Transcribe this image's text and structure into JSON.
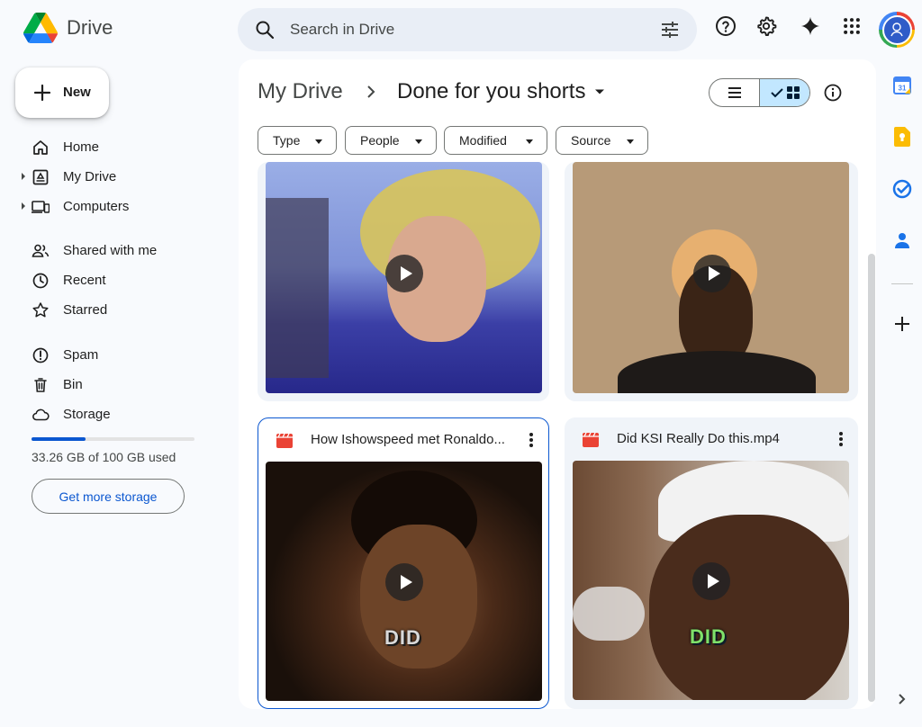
{
  "app": {
    "name": "Drive"
  },
  "search": {
    "placeholder": "Search in Drive"
  },
  "new_button": {
    "label": "New"
  },
  "nav": {
    "items": [
      {
        "label": "Home",
        "icon": "home-icon"
      },
      {
        "label": "My Drive",
        "icon": "my-drive-icon",
        "expandable": true
      },
      {
        "label": "Computers",
        "icon": "computers-icon",
        "expandable": true
      },
      {
        "label": "Shared with me",
        "icon": "shared-icon"
      },
      {
        "label": "Recent",
        "icon": "clock-icon"
      },
      {
        "label": "Starred",
        "icon": "star-icon"
      },
      {
        "label": "Spam",
        "icon": "spam-icon"
      },
      {
        "label": "Bin",
        "icon": "trash-icon"
      },
      {
        "label": "Storage",
        "icon": "cloud-icon"
      }
    ]
  },
  "storage": {
    "used_text": "33.26 GB of 100 GB used",
    "used_fraction": 0.3326,
    "cta_label": "Get more storage"
  },
  "breadcrumb": {
    "root": "My Drive",
    "current": "Done for you shorts"
  },
  "filters": [
    {
      "label": "Type"
    },
    {
      "label": "People"
    },
    {
      "label": "Modified"
    },
    {
      "label": "Source"
    }
  ],
  "files": [
    {
      "name": "How Ishowspeed met Ronaldo...",
      "caption": "DID",
      "selected": true
    },
    {
      "name": "Did KSI Really Do this.mp4",
      "caption": "DID",
      "selected": false
    }
  ],
  "colors": {
    "accent": "#0b57d0",
    "selected_bg": "#c2e7ff",
    "video_red": "#ea4335"
  }
}
